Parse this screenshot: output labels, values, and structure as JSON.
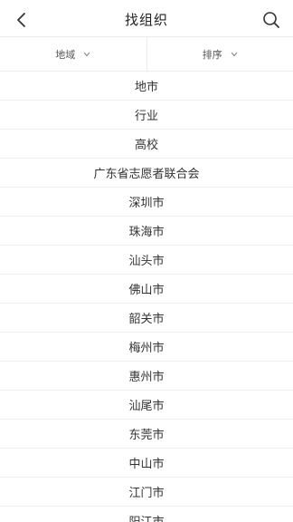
{
  "header": {
    "title": "找组织",
    "back_icon": "chevron-left-icon",
    "search_icon": "search-icon"
  },
  "filters": [
    {
      "label": "地域",
      "icon": "chevron-down-icon"
    },
    {
      "label": "排序",
      "icon": "chevron-down-icon"
    }
  ],
  "list": {
    "items": [
      "地市",
      "行业",
      "高校",
      "广东省志愿者联合会",
      "深圳市",
      "珠海市",
      "汕头市",
      "佛山市",
      "韶关市",
      "梅州市",
      "惠州市",
      "汕尾市",
      "东莞市",
      "中山市",
      "江门市",
      "阳江市"
    ]
  },
  "colors": {
    "divider": "#ececec",
    "text": "#333333"
  }
}
